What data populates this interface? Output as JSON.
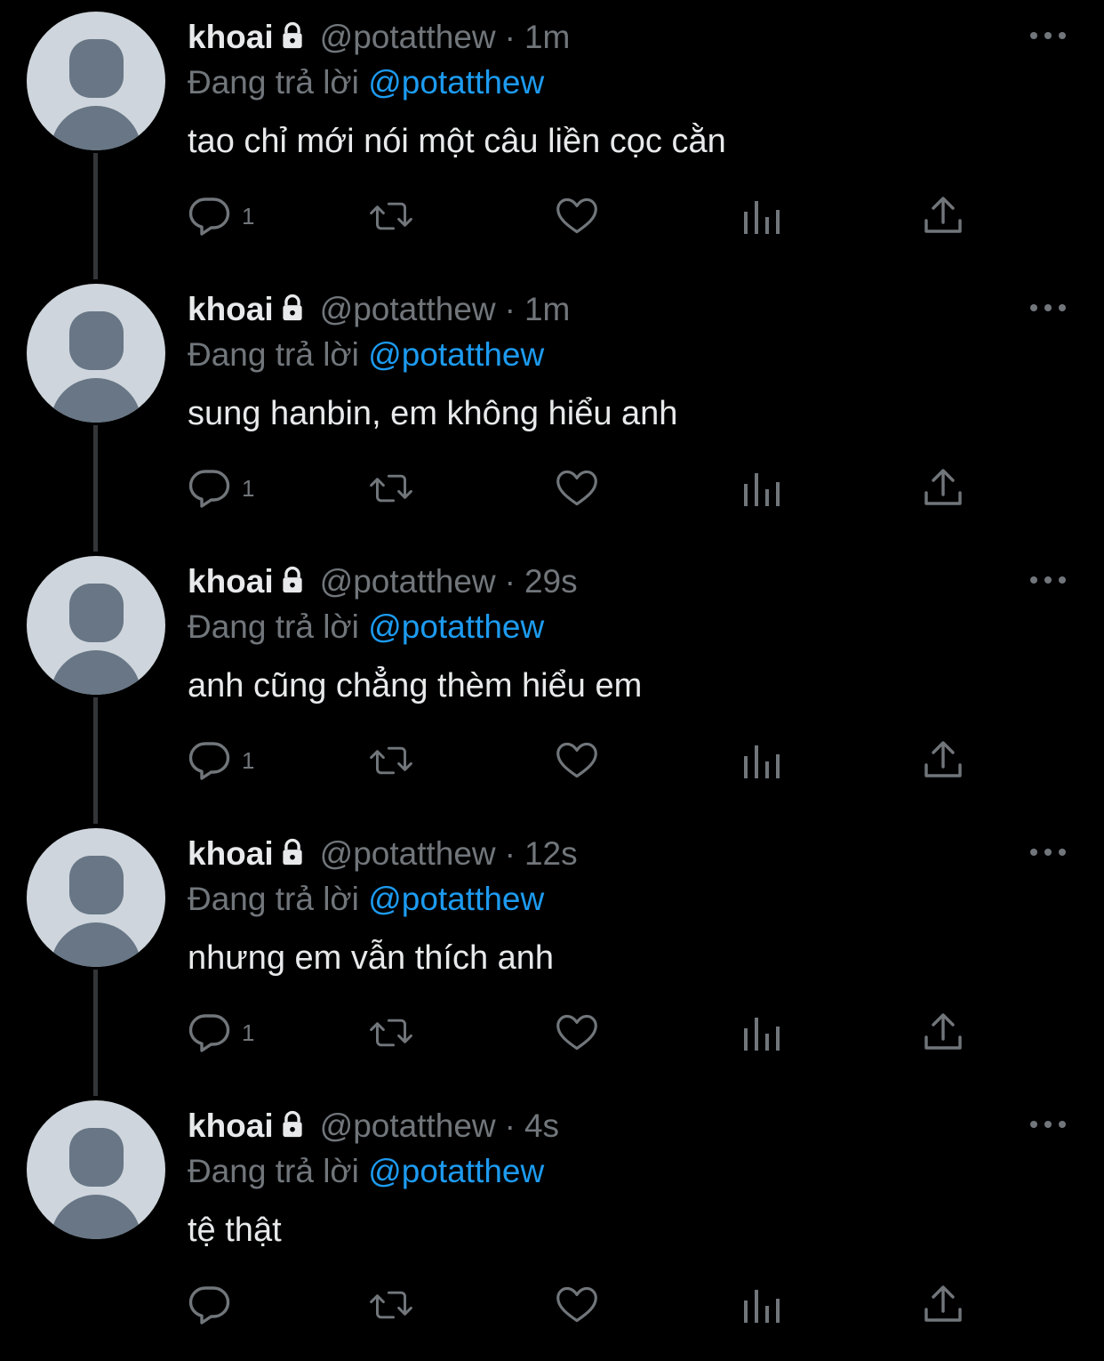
{
  "thread": {
    "tweets": [
      {
        "name": "khoai",
        "handle": "@potatthew",
        "separator": "·",
        "time": "1m",
        "reply_prefix": "Đang trả lời",
        "reply_to": "@potatthew",
        "text": "tao chỉ mới nói một câu liền cọc cằn",
        "reply_count": "1"
      },
      {
        "name": "khoai",
        "handle": "@potatthew",
        "separator": "·",
        "time": "1m",
        "reply_prefix": "Đang trả lời",
        "reply_to": "@potatthew",
        "text": "sung hanbin, em không hiểu anh",
        "reply_count": "1"
      },
      {
        "name": "khoai",
        "handle": "@potatthew",
        "separator": "·",
        "time": "29s",
        "reply_prefix": "Đang trả lời",
        "reply_to": "@potatthew",
        "text": "anh cũng chẳng thèm hiểu em",
        "reply_count": "1"
      },
      {
        "name": "khoai",
        "handle": "@potatthew",
        "separator": "·",
        "time": "12s",
        "reply_prefix": "Đang trả lời",
        "reply_to": "@potatthew",
        "text": "nhưng em vẫn thích anh",
        "reply_count": "1"
      },
      {
        "name": "khoai",
        "handle": "@potatthew",
        "separator": "·",
        "time": "4s",
        "reply_prefix": "Đang trả lời",
        "reply_to": "@potatthew",
        "text": "tệ thật",
        "reply_count": ""
      }
    ]
  },
  "icons": {
    "lock": "lock-icon",
    "more": "more-horizontal-icon",
    "reply": "reply-bubble-icon",
    "retweet": "retweet-icon",
    "like": "heart-icon",
    "views": "views-bar-chart-icon",
    "share": "share-upload-icon"
  },
  "colors": {
    "background": "#000000",
    "primary_text": "#e7e9ea",
    "secondary_text": "#71767b",
    "link": "#1d9bf0",
    "thread_line": "#333639",
    "avatar_bg": "#ced5dc",
    "avatar_fg": "#687685"
  }
}
